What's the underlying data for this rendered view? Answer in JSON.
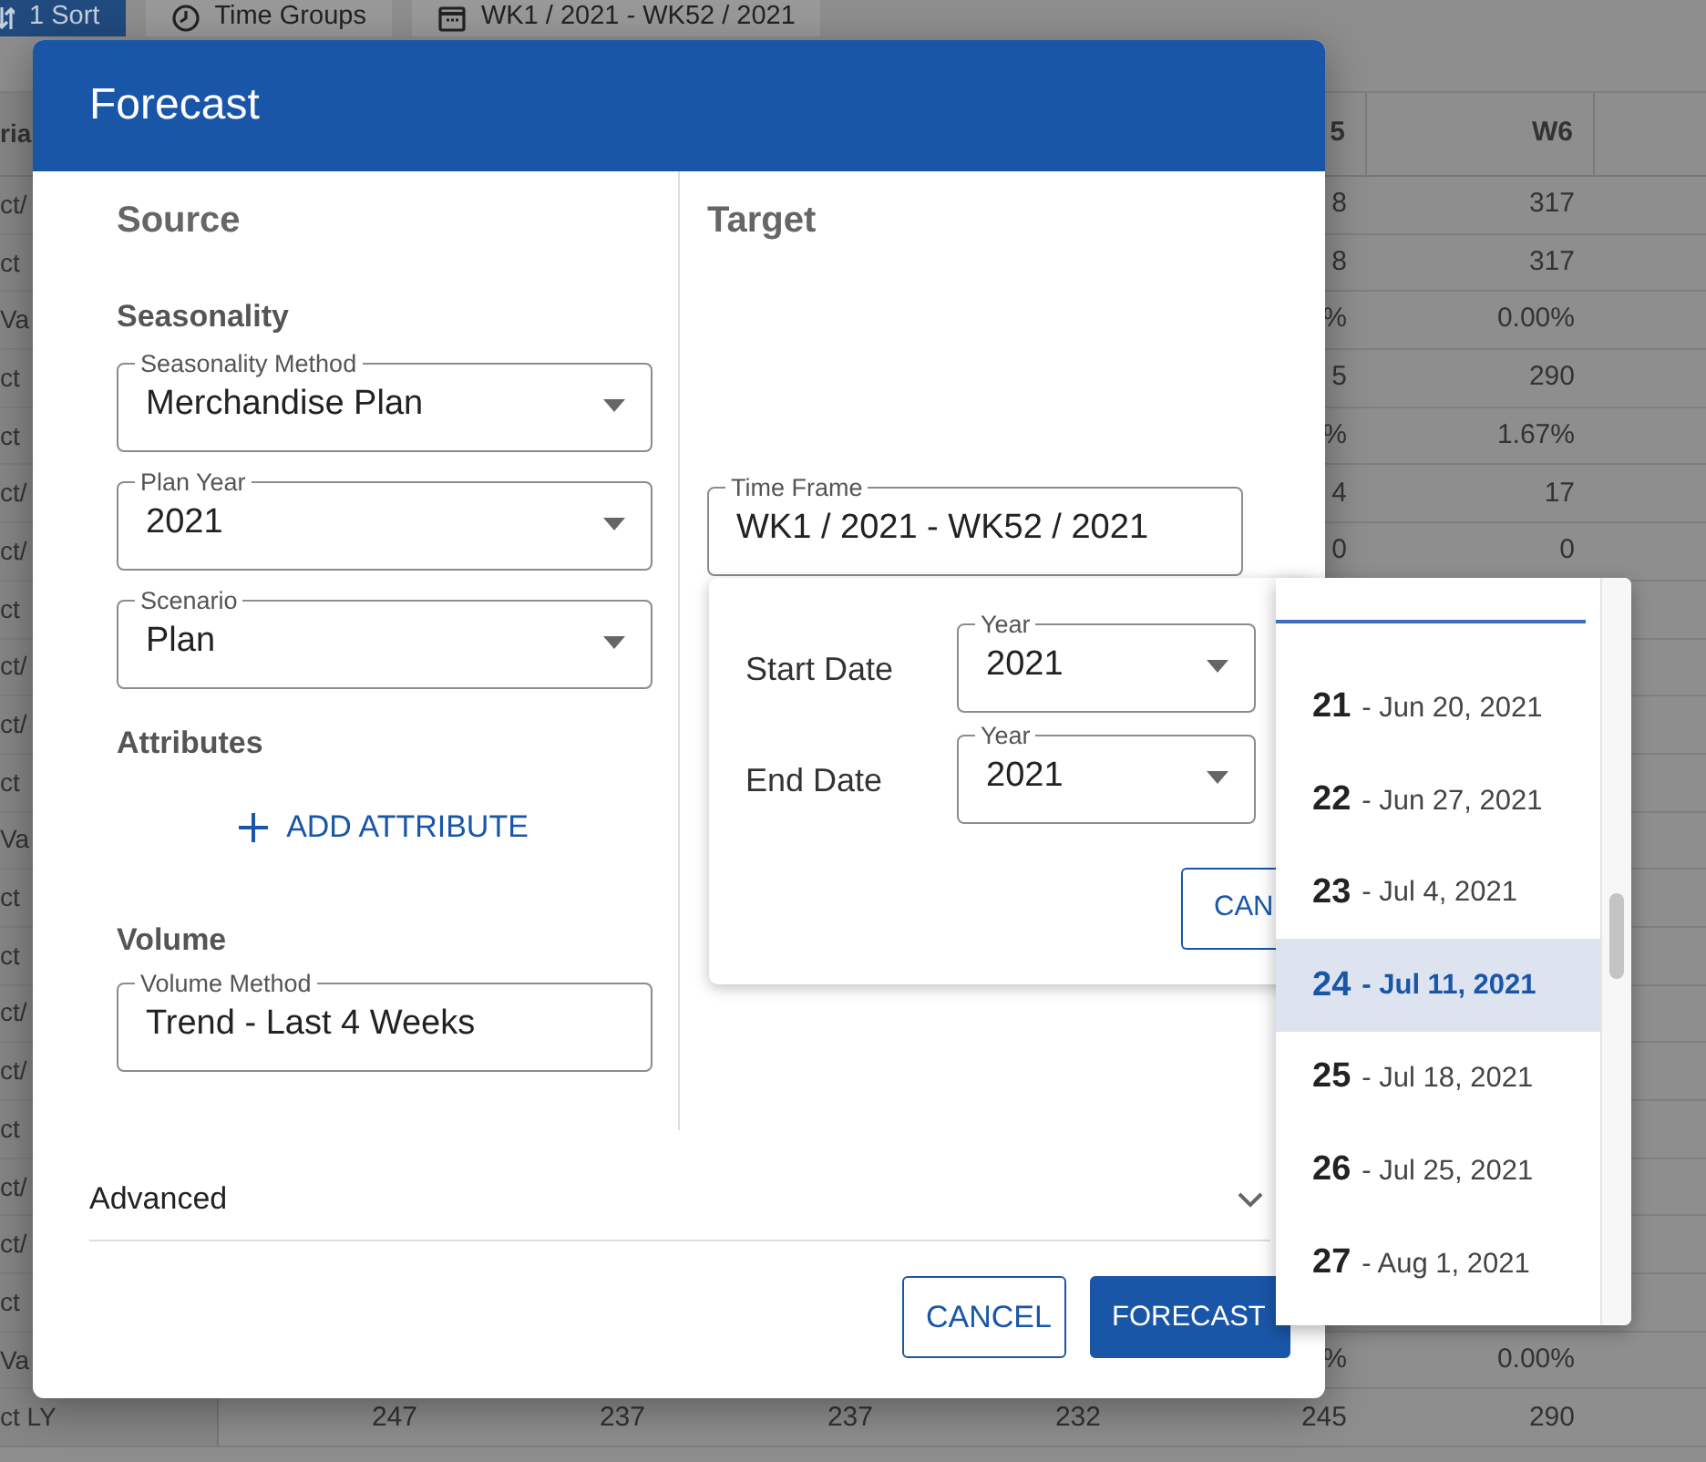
{
  "toolbar": [
    {
      "label": "1 Sort",
      "kind": "sort",
      "selected": true
    },
    {
      "label": "Time Groups",
      "kind": "clock",
      "selected": false
    },
    {
      "label": "WK1 / 2021 - WK52 / 2021",
      "kind": "calendar",
      "selected": false
    }
  ],
  "grid": {
    "columns": [
      "ria",
      null,
      null,
      null,
      null,
      "5",
      "W6"
    ],
    "rows": [
      {
        "cells": [
          "ct/",
          null,
          null,
          null,
          null,
          "8",
          "317"
        ]
      },
      {
        "cells": [
          "ct",
          null,
          null,
          null,
          null,
          "8",
          "317"
        ]
      },
      {
        "cells": [
          "Va",
          null,
          null,
          null,
          null,
          "%",
          "0.00%"
        ]
      },
      {
        "cells": [
          "ct",
          null,
          null,
          null,
          null,
          "5",
          "290"
        ]
      },
      {
        "cells": [
          "ct",
          null,
          null,
          null,
          null,
          "%",
          "1.67%"
        ]
      },
      {
        "cells": [
          "ct/",
          null,
          null,
          null,
          null,
          "4",
          "17"
        ]
      },
      {
        "cells": [
          "ct/",
          null,
          null,
          null,
          null,
          "0",
          "0"
        ]
      },
      {
        "cells": [
          "ct",
          null,
          null,
          null,
          null,
          null,
          null
        ]
      },
      {
        "cells": [
          "ct/",
          null,
          null,
          null,
          null,
          null,
          null
        ]
      },
      {
        "cells": [
          "ct/",
          null,
          null,
          null,
          null,
          null,
          null
        ]
      },
      {
        "cells": [
          "ct",
          null,
          null,
          null,
          null,
          null,
          null
        ]
      },
      {
        "cells": [
          "Va",
          null,
          null,
          null,
          null,
          null,
          null
        ]
      },
      {
        "cells": [
          "ct",
          null,
          null,
          null,
          null,
          null,
          null
        ]
      },
      {
        "cells": [
          "ct",
          null,
          null,
          null,
          null,
          null,
          null
        ]
      },
      {
        "cells": [
          "ct/",
          null,
          null,
          null,
          null,
          null,
          null
        ]
      },
      {
        "cells": [
          "ct/",
          null,
          null,
          null,
          null,
          null,
          null
        ]
      },
      {
        "cells": [
          "ct",
          null,
          null,
          null,
          null,
          null,
          null
        ]
      },
      {
        "cells": [
          "ct/",
          null,
          null,
          null,
          null,
          null,
          null
        ]
      },
      {
        "cells": [
          "ct/",
          null,
          null,
          null,
          null,
          null,
          null
        ]
      },
      {
        "cells": [
          "ct",
          null,
          null,
          null,
          null,
          null,
          null
        ]
      },
      {
        "cells": [
          "Va",
          null,
          null,
          null,
          null,
          "%",
          "0.00%"
        ]
      },
      {
        "cells": [
          "ct LY",
          "247",
          "237",
          "237",
          "232",
          "245",
          "290"
        ]
      }
    ]
  },
  "dialog": {
    "title": "Forecast",
    "source": {
      "heading": "Source",
      "seasonality": {
        "heading": "Seasonality",
        "fields": [
          {
            "label": "Seasonality Method",
            "value": "Merchandise Plan",
            "kind": "select"
          },
          {
            "label": "Plan Year",
            "value": "2021",
            "kind": "select"
          },
          {
            "label": "Scenario",
            "value": "Plan",
            "kind": "select"
          }
        ]
      },
      "attributes": {
        "heading": "Attributes",
        "add_button": "ADD ATTRIBUTE"
      },
      "volume": {
        "heading": "Volume",
        "fields": [
          {
            "label": "Volume Method",
            "value": "Trend - Last 4 Weeks",
            "kind": "text"
          }
        ]
      }
    },
    "target": {
      "heading": "Target",
      "time_frame": {
        "label": "Time Frame",
        "value": "WK1 / 2021 - WK52 / 2021",
        "kind": "text"
      }
    },
    "advanced": {
      "label": "Advanced",
      "expanded": false
    },
    "buttons": [
      {
        "label": "CANCEL",
        "kind": "outline"
      },
      {
        "label": "FORECAST",
        "kind": "primary"
      }
    ]
  },
  "date_popover": {
    "rows": [
      {
        "label": "Start Date",
        "field": {
          "label": "Year",
          "value": "2021",
          "kind": "select"
        }
      },
      {
        "label": "End Date",
        "field": {
          "label": "Year",
          "value": "2021",
          "kind": "select"
        }
      }
    ],
    "button": "CAN"
  },
  "week_list": {
    "items": [
      {
        "week": "21",
        "date": "- Jun 20, 2021",
        "selected": false
      },
      {
        "week": "22",
        "date": "- Jun 27, 2021",
        "selected": false
      },
      {
        "week": "23",
        "date": "- Jul 4, 2021",
        "selected": false
      },
      {
        "week": "24",
        "date": "- Jul 11, 2021",
        "selected": true
      },
      {
        "week": "25",
        "date": "- Jul 18, 2021",
        "selected": false
      },
      {
        "week": "26",
        "date": "- Jul 25, 2021",
        "selected": false
      },
      {
        "week": "27",
        "date": "- Aug 1, 2021",
        "selected": false
      }
    ]
  }
}
